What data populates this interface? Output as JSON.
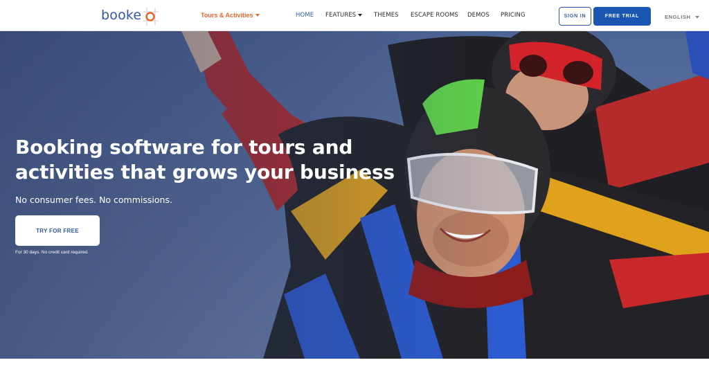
{
  "header": {
    "logo_text": "booke",
    "audience_label": "Tours & Activities",
    "nav": [
      {
        "label": "HOME"
      },
      {
        "label": "FEATURES"
      },
      {
        "label": "THEMES"
      },
      {
        "label": "ESCAPE ROOMS"
      },
      {
        "label": "DEMOS"
      },
      {
        "label": "PRICING"
      }
    ],
    "sign_in_label": "SIGN IN",
    "free_trial_label": "FREE TRIAL",
    "language_label": "ENGLISH"
  },
  "hero": {
    "headline": "Booking software for tours and activities that grows your business",
    "subline": "No consumer fees. No commissions.",
    "cta_label": "TRY FOR FREE",
    "cta_note": "For 30 days. No credit card required."
  },
  "colors": {
    "brand_blue": "#2f56a8",
    "trial_blue": "#1b56b3",
    "accent_orange": "#e8632b"
  }
}
